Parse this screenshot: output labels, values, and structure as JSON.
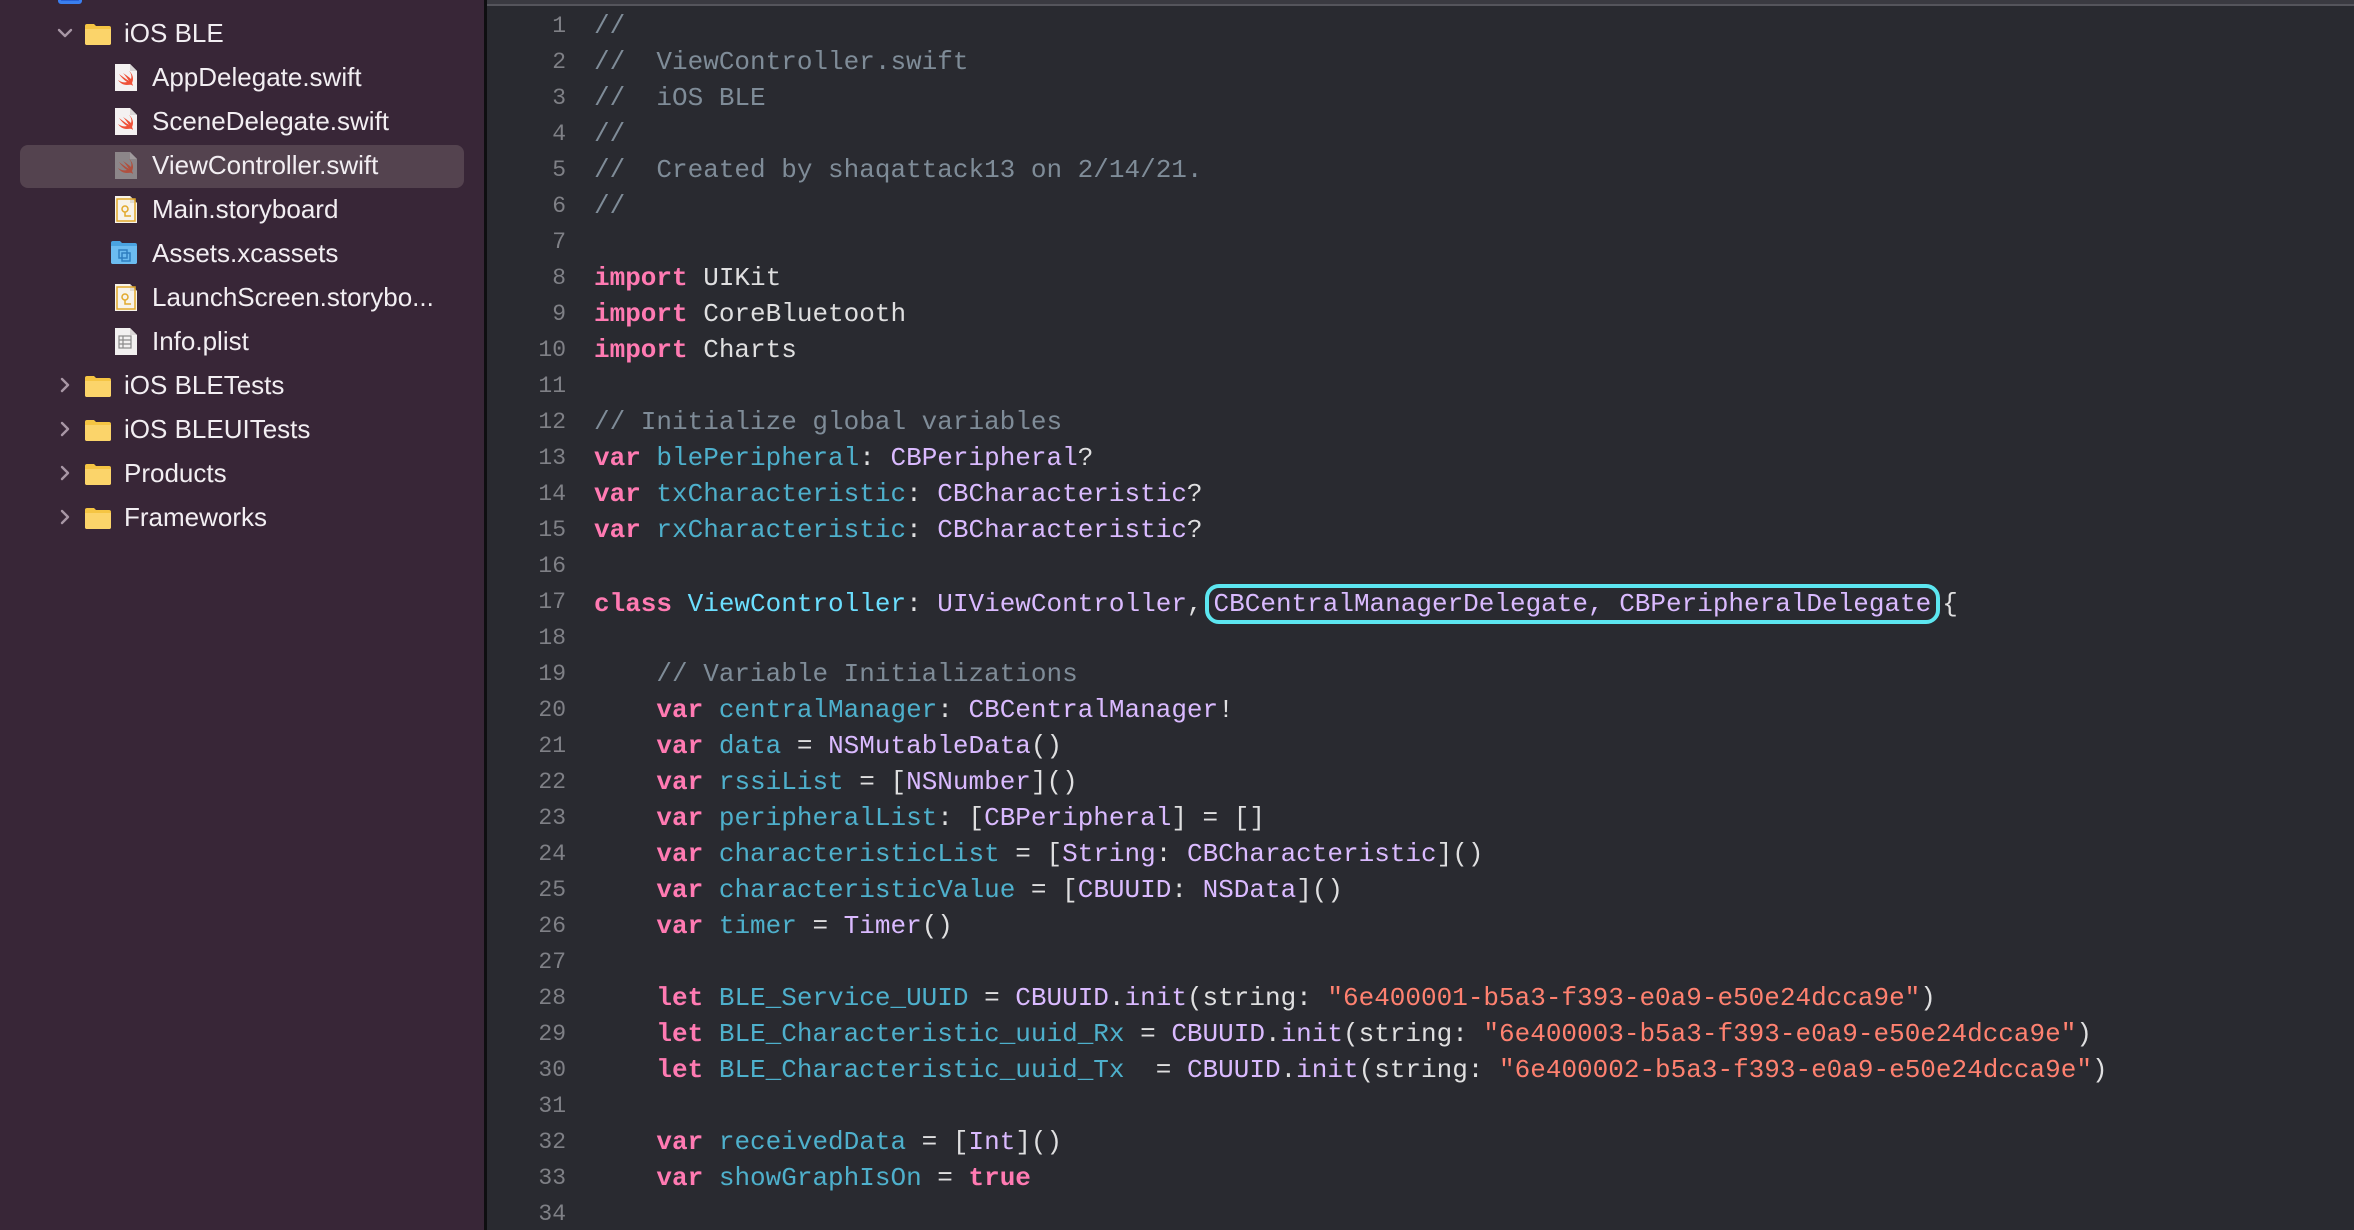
{
  "sidebar": {
    "project_stub_label": "...",
    "items": [
      {
        "type": "folder",
        "label": "iOS BLE",
        "expanded": true,
        "level": 0,
        "icon": "folder-icon"
      },
      {
        "type": "file",
        "label": "AppDelegate.swift",
        "level": 1,
        "icon": "swift-file-icon"
      },
      {
        "type": "file",
        "label": "SceneDelegate.swift",
        "level": 1,
        "icon": "swift-file-icon"
      },
      {
        "type": "file",
        "label": "ViewController.swift",
        "level": 1,
        "icon": "swift-file-icon",
        "selected": true
      },
      {
        "type": "file",
        "label": "Main.storyboard",
        "level": 1,
        "icon": "storyboard-file-icon"
      },
      {
        "type": "file",
        "label": "Assets.xcassets",
        "level": 1,
        "icon": "asset-catalog-icon"
      },
      {
        "type": "file",
        "label": "LaunchScreen.storybo...",
        "level": 1,
        "icon": "storyboard-file-icon"
      },
      {
        "type": "file",
        "label": "Info.plist",
        "level": 1,
        "icon": "plist-file-icon"
      },
      {
        "type": "folder",
        "label": "iOS BLETests",
        "expanded": false,
        "level": 0,
        "icon": "folder-icon"
      },
      {
        "type": "folder",
        "label": "iOS BLEUITests",
        "expanded": false,
        "level": 0,
        "icon": "folder-icon"
      },
      {
        "type": "folder",
        "label": "Products",
        "expanded": false,
        "level": 0,
        "icon": "folder-icon"
      },
      {
        "type": "folder",
        "label": "Frameworks",
        "expanded": false,
        "level": 0,
        "icon": "folder-icon"
      }
    ]
  },
  "editor": {
    "file_name": "ViewController.swift",
    "highlight_annotation": {
      "line": 17,
      "text": "CBCentralManagerDelegate, CBPeripheralDelegate",
      "color": "#5ce6f0"
    },
    "lines": [
      {
        "n": "1",
        "tokens": [
          [
            "comment",
            "//"
          ]
        ]
      },
      {
        "n": "2",
        "tokens": [
          [
            "comment",
            "//  ViewController.swift"
          ]
        ]
      },
      {
        "n": "3",
        "tokens": [
          [
            "comment",
            "//  iOS BLE"
          ]
        ]
      },
      {
        "n": "4",
        "tokens": [
          [
            "comment",
            "//"
          ]
        ]
      },
      {
        "n": "5",
        "tokens": [
          [
            "comment",
            "//  Created by shaqattack13 on 2/14/21."
          ]
        ]
      },
      {
        "n": "6",
        "tokens": [
          [
            "comment",
            "//"
          ]
        ]
      },
      {
        "n": "7",
        "tokens": []
      },
      {
        "n": "8",
        "tokens": [
          [
            "kw",
            "import"
          ],
          [
            "plain",
            " UIKit"
          ]
        ]
      },
      {
        "n": "9",
        "tokens": [
          [
            "kw",
            "import"
          ],
          [
            "plain",
            " CoreBluetooth"
          ]
        ]
      },
      {
        "n": "10",
        "tokens": [
          [
            "kw",
            "import"
          ],
          [
            "plain",
            " Charts"
          ]
        ]
      },
      {
        "n": "11",
        "tokens": []
      },
      {
        "n": "12",
        "tokens": [
          [
            "comment",
            "// Initialize global variables"
          ]
        ]
      },
      {
        "n": "13",
        "tokens": [
          [
            "kw",
            "var"
          ],
          [
            "plain",
            " "
          ],
          [
            "var",
            "blePeripheral"
          ],
          [
            "plain",
            ": "
          ],
          [
            "type",
            "CBPeripheral"
          ],
          [
            "plain",
            "?"
          ]
        ]
      },
      {
        "n": "14",
        "tokens": [
          [
            "kw",
            "var"
          ],
          [
            "plain",
            " "
          ],
          [
            "var",
            "txCharacteristic"
          ],
          [
            "plain",
            ": "
          ],
          [
            "type",
            "CBCharacteristic"
          ],
          [
            "plain",
            "?"
          ]
        ]
      },
      {
        "n": "15",
        "tokens": [
          [
            "kw",
            "var"
          ],
          [
            "plain",
            " "
          ],
          [
            "var",
            "rxCharacteristic"
          ],
          [
            "plain",
            ": "
          ],
          [
            "type",
            "CBCharacteristic"
          ],
          [
            "plain",
            "?"
          ]
        ]
      },
      {
        "n": "16",
        "tokens": []
      },
      {
        "n": "17",
        "tokens": [
          [
            "kw",
            "class"
          ],
          [
            "plain",
            " "
          ],
          [
            "decl",
            "ViewController"
          ],
          [
            "plain",
            ": "
          ],
          [
            "type",
            "UIViewController"
          ],
          [
            "plain",
            ","
          ],
          [
            "highlight",
            "CBCentralManagerDelegate, CBPeripheralDelegate"
          ],
          [
            "plain",
            "{"
          ]
        ]
      },
      {
        "n": "18",
        "tokens": []
      },
      {
        "n": "19",
        "tokens": [
          [
            "plain",
            "    "
          ],
          [
            "comment",
            "// Variable Initializations"
          ]
        ]
      },
      {
        "n": "20",
        "tokens": [
          [
            "plain",
            "    "
          ],
          [
            "kw",
            "var"
          ],
          [
            "plain",
            " "
          ],
          [
            "var",
            "centralManager"
          ],
          [
            "plain",
            ": "
          ],
          [
            "type",
            "CBCentralManager"
          ],
          [
            "plain",
            "!"
          ]
        ]
      },
      {
        "n": "21",
        "tokens": [
          [
            "plain",
            "    "
          ],
          [
            "kw",
            "var"
          ],
          [
            "plain",
            " "
          ],
          [
            "var",
            "data"
          ],
          [
            "plain",
            " = "
          ],
          [
            "type",
            "NSMutableData"
          ],
          [
            "plain",
            "()"
          ]
        ]
      },
      {
        "n": "22",
        "tokens": [
          [
            "plain",
            "    "
          ],
          [
            "kw",
            "var"
          ],
          [
            "plain",
            " "
          ],
          [
            "var",
            "rssiList"
          ],
          [
            "plain",
            " = ["
          ],
          [
            "type",
            "NSNumber"
          ],
          [
            "plain",
            "]()"
          ]
        ]
      },
      {
        "n": "23",
        "tokens": [
          [
            "plain",
            "    "
          ],
          [
            "kw",
            "var"
          ],
          [
            "plain",
            " "
          ],
          [
            "var",
            "peripheralList"
          ],
          [
            "plain",
            ": ["
          ],
          [
            "type",
            "CBPeripheral"
          ],
          [
            "plain",
            "] = []"
          ]
        ]
      },
      {
        "n": "24",
        "tokens": [
          [
            "plain",
            "    "
          ],
          [
            "kw",
            "var"
          ],
          [
            "plain",
            " "
          ],
          [
            "var",
            "characteristicList"
          ],
          [
            "plain",
            " = ["
          ],
          [
            "type",
            "String"
          ],
          [
            "plain",
            ": "
          ],
          [
            "type",
            "CBCharacteristic"
          ],
          [
            "plain",
            "]()"
          ]
        ]
      },
      {
        "n": "25",
        "tokens": [
          [
            "plain",
            "    "
          ],
          [
            "kw",
            "var"
          ],
          [
            "plain",
            " "
          ],
          [
            "var",
            "characteristicValue"
          ],
          [
            "plain",
            " = ["
          ],
          [
            "type",
            "CBUUID"
          ],
          [
            "plain",
            ": "
          ],
          [
            "type",
            "NSData"
          ],
          [
            "plain",
            "]()"
          ]
        ]
      },
      {
        "n": "26",
        "tokens": [
          [
            "plain",
            "    "
          ],
          [
            "kw",
            "var"
          ],
          [
            "plain",
            " "
          ],
          [
            "var",
            "timer"
          ],
          [
            "plain",
            " = "
          ],
          [
            "type",
            "Timer"
          ],
          [
            "plain",
            "()"
          ]
        ]
      },
      {
        "n": "27",
        "tokens": []
      },
      {
        "n": "28",
        "tokens": [
          [
            "plain",
            "    "
          ],
          [
            "kw",
            "let"
          ],
          [
            "plain",
            " "
          ],
          [
            "var",
            "BLE_Service_UUID"
          ],
          [
            "plain",
            " = "
          ],
          [
            "type",
            "CBUUID"
          ],
          [
            "plain",
            "."
          ],
          [
            "type",
            "init"
          ],
          [
            "plain",
            "(string: "
          ],
          [
            "str",
            "\"6e400001-b5a3-f393-e0a9-e50e24dcca9e\""
          ],
          [
            "plain",
            ")"
          ]
        ]
      },
      {
        "n": "29",
        "tokens": [
          [
            "plain",
            "    "
          ],
          [
            "kw",
            "let"
          ],
          [
            "plain",
            " "
          ],
          [
            "var",
            "BLE_Characteristic_uuid_Rx"
          ],
          [
            "plain",
            " = "
          ],
          [
            "type",
            "CBUUID"
          ],
          [
            "plain",
            "."
          ],
          [
            "type",
            "init"
          ],
          [
            "plain",
            "(string: "
          ],
          [
            "str",
            "\"6e400003-b5a3-f393-e0a9-e50e24dcca9e\""
          ],
          [
            "plain",
            ")"
          ]
        ]
      },
      {
        "n": "30",
        "tokens": [
          [
            "plain",
            "    "
          ],
          [
            "kw",
            "let"
          ],
          [
            "plain",
            " "
          ],
          [
            "var",
            "BLE_Characteristic_uuid_Tx"
          ],
          [
            "plain",
            "  = "
          ],
          [
            "type",
            "CBUUID"
          ],
          [
            "plain",
            "."
          ],
          [
            "type",
            "init"
          ],
          [
            "plain",
            "(string: "
          ],
          [
            "str",
            "\"6e400002-b5a3-f393-e0a9-e50e24dcca9e\""
          ],
          [
            "plain",
            ")"
          ]
        ]
      },
      {
        "n": "31",
        "tokens": []
      },
      {
        "n": "32",
        "tokens": [
          [
            "plain",
            "    "
          ],
          [
            "kw",
            "var"
          ],
          [
            "plain",
            " "
          ],
          [
            "var",
            "receivedData"
          ],
          [
            "plain",
            " = ["
          ],
          [
            "type",
            "Int"
          ],
          [
            "plain",
            "]()"
          ]
        ]
      },
      {
        "n": "33",
        "tokens": [
          [
            "plain",
            "    "
          ],
          [
            "kw",
            "var"
          ],
          [
            "plain",
            " "
          ],
          [
            "var",
            "showGraphIsOn"
          ],
          [
            "plain",
            " = "
          ],
          [
            "kw",
            "true"
          ]
        ]
      },
      {
        "n": "34",
        "tokens": []
      }
    ]
  },
  "colors": {
    "sidebar_bg": "#382637",
    "editor_bg": "#292a30",
    "keyword": "#ff7ab2",
    "type": "#dabaff",
    "variable": "#4eb0cc",
    "declaration": "#6bdfff",
    "comment": "#7f8c98",
    "string": "#ff8170",
    "highlight_box": "#5ce6f0"
  }
}
